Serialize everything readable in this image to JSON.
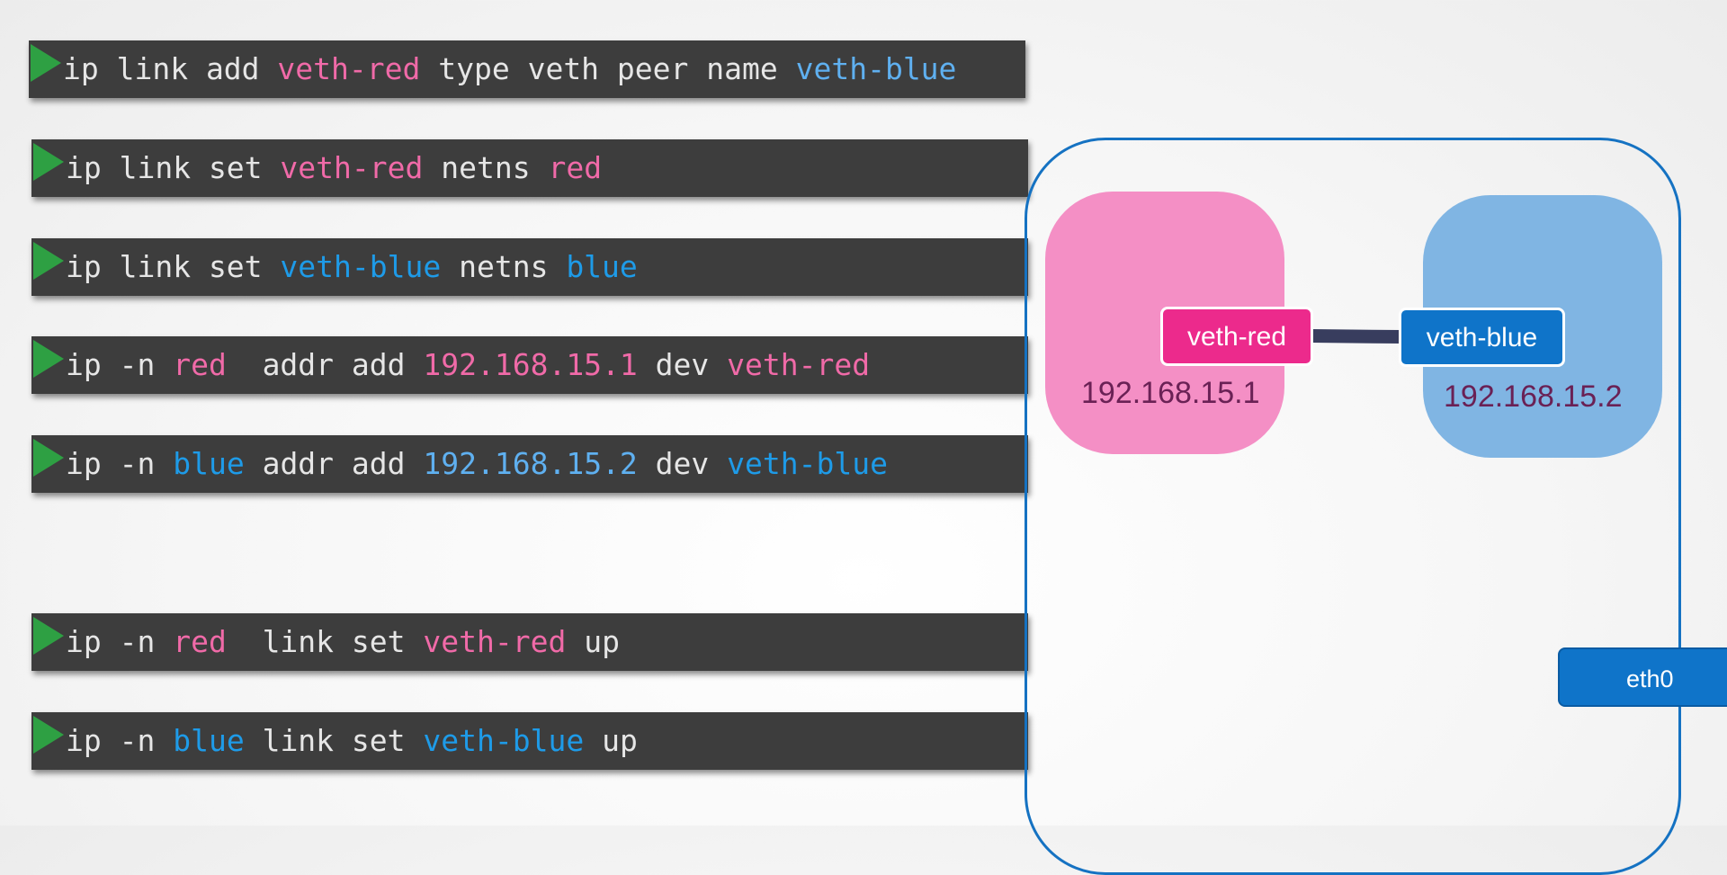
{
  "commands": [
    {
      "tokens": [
        {
          "text": "ip link add ",
          "color": "plain"
        },
        {
          "text": "veth-red",
          "color": "pink"
        },
        {
          "text": " type veth peer name ",
          "color": "plain"
        },
        {
          "text": "veth-blue",
          "color": "lblue"
        }
      ]
    },
    {
      "tokens": [
        {
          "text": "ip link set ",
          "color": "plain"
        },
        {
          "text": "veth-red",
          "color": "pink"
        },
        {
          "text": " netns ",
          "color": "plain"
        },
        {
          "text": "red",
          "color": "pink"
        }
      ]
    },
    {
      "tokens": [
        {
          "text": "ip link set ",
          "color": "plain"
        },
        {
          "text": "veth-blue",
          "color": "blue"
        },
        {
          "text": " netns ",
          "color": "plain"
        },
        {
          "text": "blue",
          "color": "blue"
        }
      ]
    },
    {
      "tokens": [
        {
          "text": "ip -n ",
          "color": "plain"
        },
        {
          "text": "red",
          "color": "pink"
        },
        {
          "text": "  addr add ",
          "color": "plain"
        },
        {
          "text": "192.168.15.1",
          "color": "pink"
        },
        {
          "text": " dev ",
          "color": "plain"
        },
        {
          "text": "veth-red",
          "color": "pink"
        }
      ]
    },
    {
      "tokens": [
        {
          "text": "ip -n ",
          "color": "plain"
        },
        {
          "text": "blue",
          "color": "blue"
        },
        {
          "text": " addr add ",
          "color": "plain"
        },
        {
          "text": "192.168.15.2",
          "color": "lblue"
        },
        {
          "text": " dev ",
          "color": "plain"
        },
        {
          "text": "veth-blue",
          "color": "blue"
        }
      ]
    },
    {
      "tokens": [
        {
          "text": "ip -n ",
          "color": "plain"
        },
        {
          "text": "red",
          "color": "pink"
        },
        {
          "text": "  link set ",
          "color": "plain"
        },
        {
          "text": "veth-red",
          "color": "pink"
        },
        {
          "text": " up",
          "color": "plain"
        }
      ]
    },
    {
      "tokens": [
        {
          "text": "ip -n ",
          "color": "plain"
        },
        {
          "text": "blue",
          "color": "blue"
        },
        {
          "text": " link set ",
          "color": "plain"
        },
        {
          "text": "veth-blue",
          "color": "blue"
        },
        {
          "text": " up",
          "color": "plain"
        }
      ]
    }
  ],
  "diagram": {
    "red_ns": {
      "ip": "192.168.15.1",
      "interface": "veth-red",
      "color": "#f48fc5",
      "interface_color": "#ec2a8c"
    },
    "blue_ns": {
      "ip": "192.168.15.2",
      "interface": "veth-blue",
      "color": "#80b5e3",
      "interface_color": "#0f74c9"
    },
    "host_interface": "eth0",
    "link_color": "#383d5e",
    "host_border_color": "#1572c2"
  },
  "colors": {
    "command_bg": "#3d3d3d",
    "play_icon": "#2ea043",
    "plain": "#e6e6e6",
    "pink": "#f06aa8",
    "blue": "#1e9be8",
    "lblue": "#5fb0f0"
  }
}
